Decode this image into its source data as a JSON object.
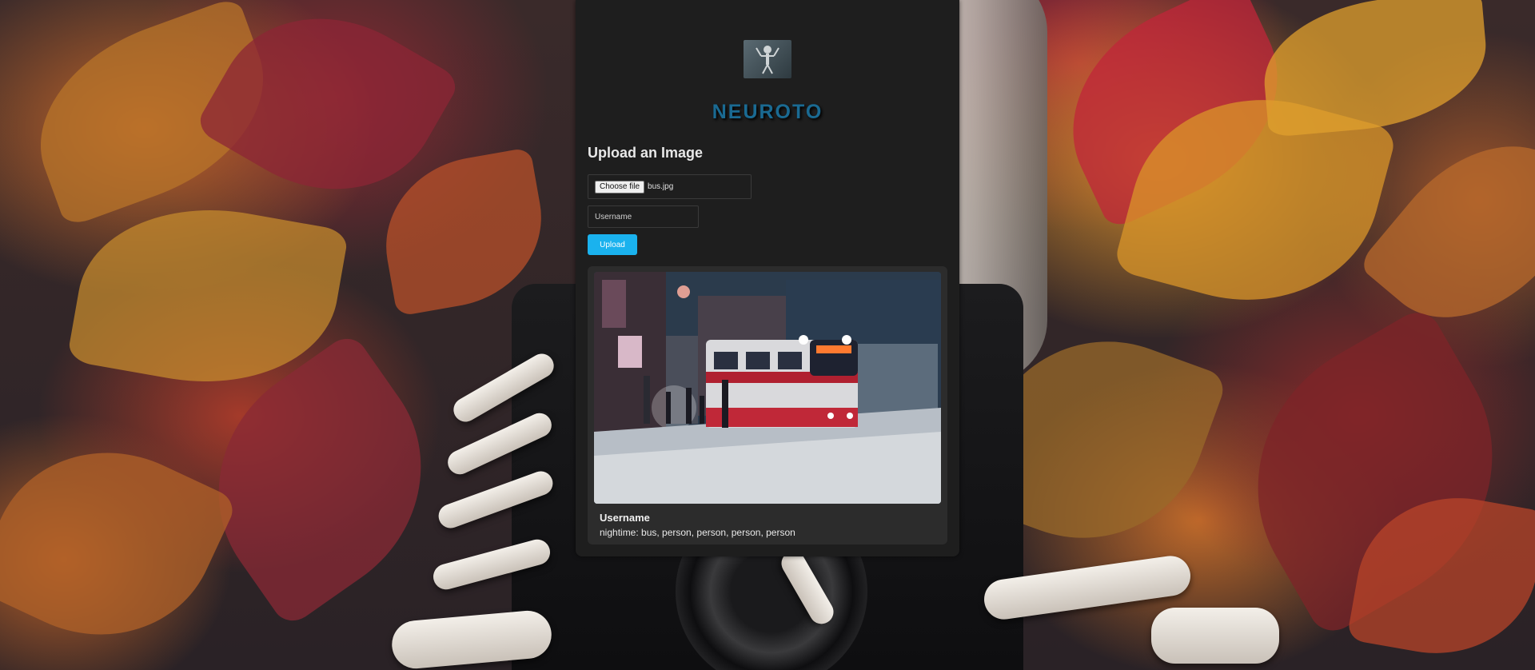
{
  "brand": {
    "name": "NEUROTO",
    "color": "#1a6a92",
    "logo_icon": "skeleton-photographer-logo"
  },
  "upload_form": {
    "heading": "Upload an Image",
    "file_input": {
      "button_label": "Choose file",
      "selected_file": "bus.jpg"
    },
    "username_input": {
      "placeholder": "Username",
      "value": ""
    },
    "upload_button": {
      "label": "Upload",
      "color": "#1ab2ee"
    }
  },
  "result": {
    "image_subject": "snowy-night-streetcar-photo",
    "username": "Username",
    "detection": "nightime: bus, person, person, person, person"
  },
  "theme": {
    "panel_bg": "#1e1e1e",
    "card_bg": "#2c2c2c"
  }
}
